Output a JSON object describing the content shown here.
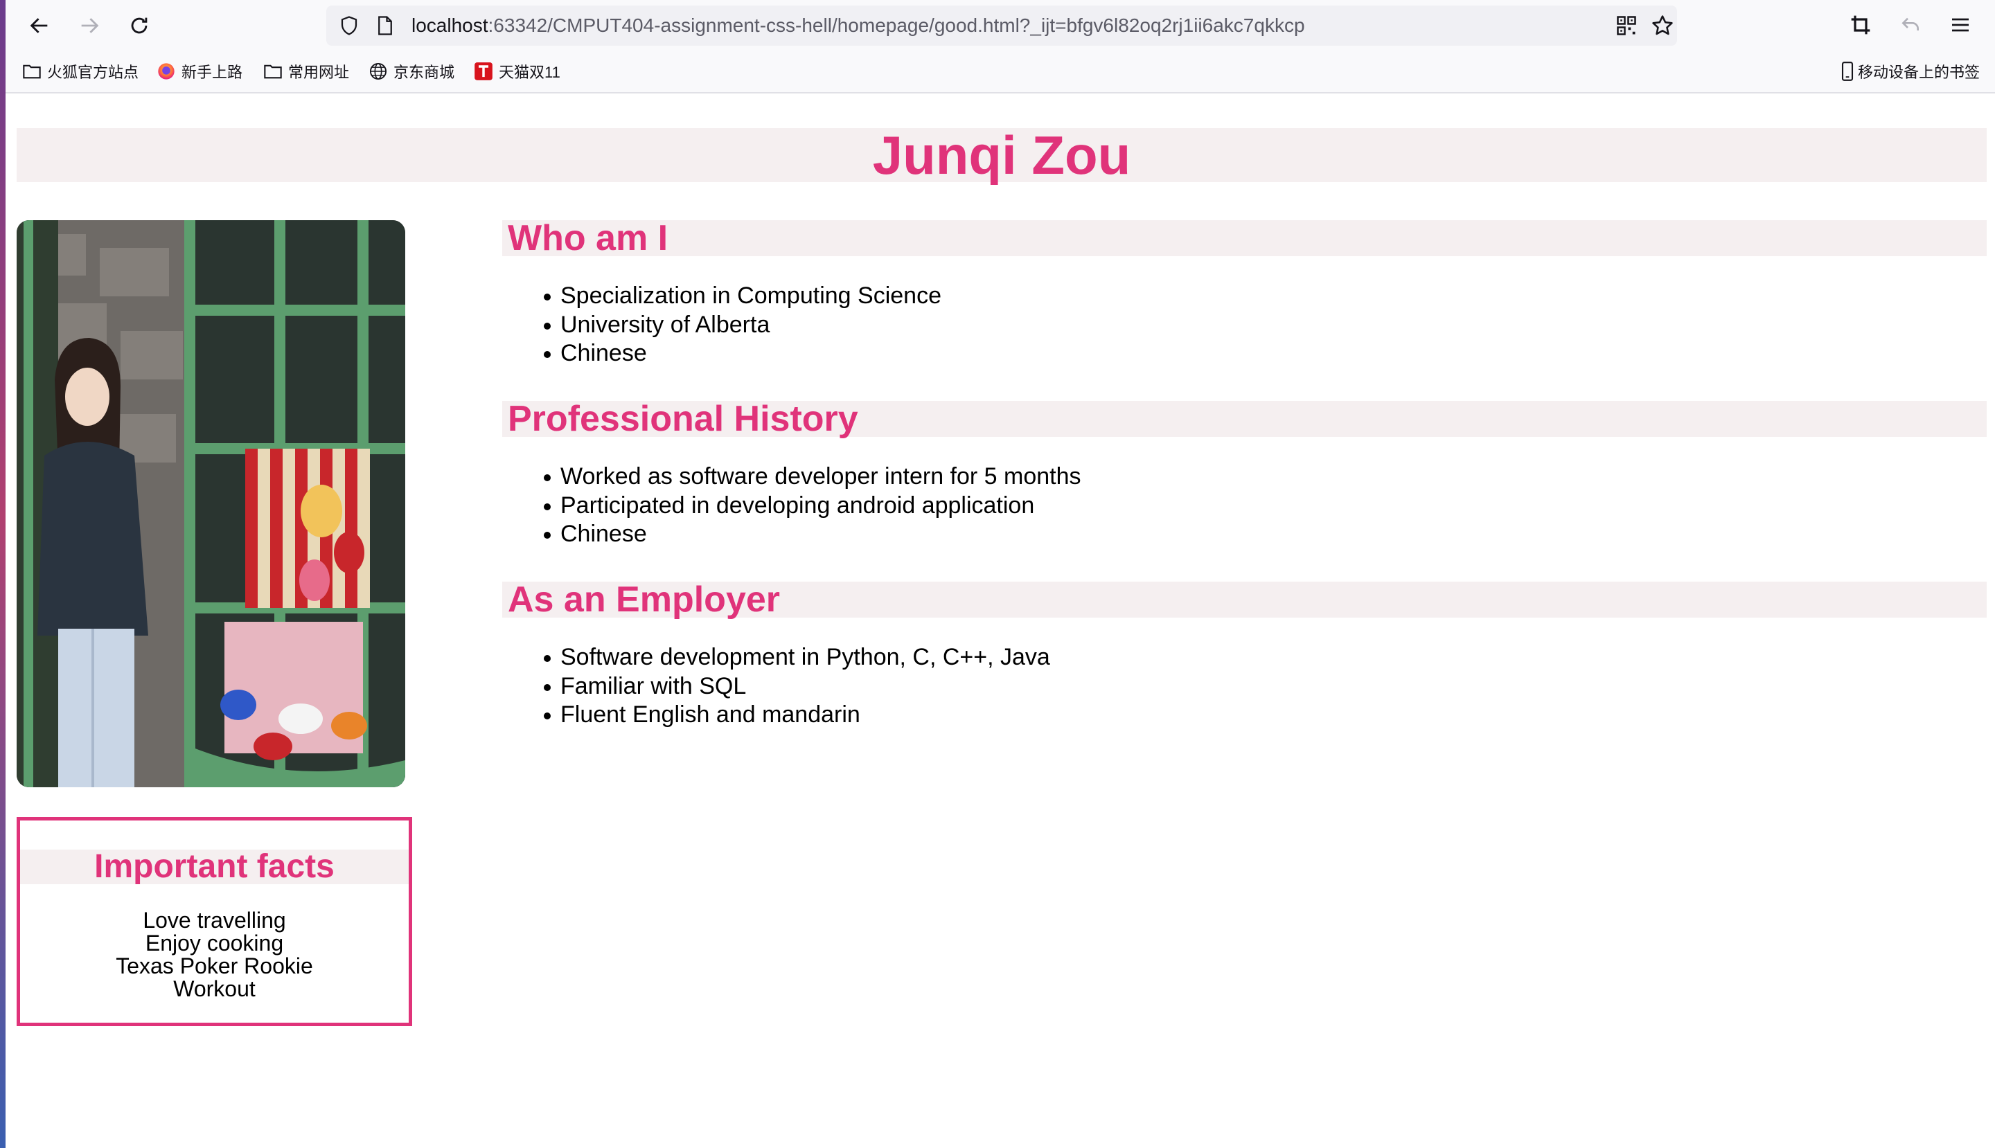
{
  "browser": {
    "url_host": "localhost",
    "url_rest": ":63342/CMPUT404-assignment-css-hell/homepage/good.html?_ijt=bfgv6l82oq2rj1ii6akc7qkkcp",
    "bookmarks": [
      {
        "label": "火狐官方站点",
        "icon": "folder-icon"
      },
      {
        "label": "新手上路",
        "icon": "firefox-icon"
      },
      {
        "label": "常用网址",
        "icon": "folder-icon"
      },
      {
        "label": "京东商城",
        "icon": "globe-icon"
      },
      {
        "label": "天猫双11",
        "icon": "tmall-icon"
      }
    ],
    "mobile_bookmarks": "移动设备上的书签"
  },
  "page": {
    "name": "Junqi Zou",
    "facts": {
      "title": "Important facts",
      "items": [
        "Love travelling",
        "Enjoy cooking",
        "Texas Poker Rookie",
        "Workout"
      ]
    },
    "sections": [
      {
        "title": "Who am I",
        "items": [
          "Specialization in Computing Science",
          "University of Alberta",
          "Chinese"
        ]
      },
      {
        "title": "Professional History",
        "items": [
          "Worked as software developer intern for 5 months",
          "Participated in developing android application",
          "Chinese"
        ]
      },
      {
        "title": "As an Employer",
        "items": [
          "Software development in Python, C, C++, Java",
          "Familiar with SQL",
          "Fluent English and mandarin"
        ]
      }
    ]
  },
  "colors": {
    "accent": "#e0337a",
    "banner_bg": "#f5eff0"
  }
}
